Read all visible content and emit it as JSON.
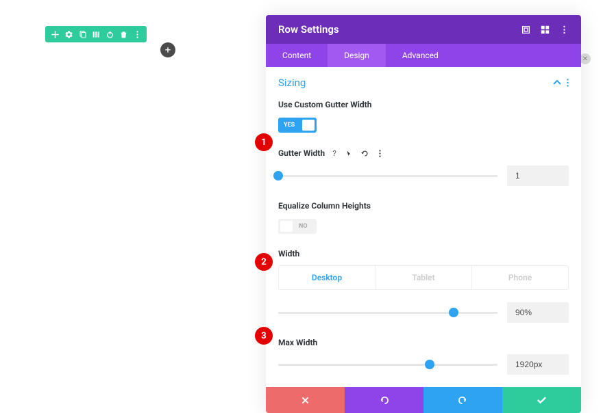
{
  "toolbar": {
    "icons": [
      "move",
      "gear",
      "copy",
      "columns",
      "power",
      "trash",
      "more"
    ]
  },
  "modal": {
    "title": "Row Settings",
    "header_icons": [
      "expand",
      "grid",
      "more"
    ],
    "tabs": {
      "content": "Content",
      "design": "Design",
      "advanced": "Advanced"
    },
    "active_tab": "design"
  },
  "section": {
    "title": "Sizing"
  },
  "fields": {
    "use_custom_gutter": {
      "label": "Use Custom Gutter Width",
      "toggle_text": "YES"
    },
    "gutter_width": {
      "label": "Gutter Width",
      "value": "1",
      "thumb_pct": 0
    },
    "equalize": {
      "label": "Equalize Column Heights",
      "toggle_text": "NO"
    },
    "width": {
      "label": "Width",
      "value": "90%",
      "thumb_pct": 80,
      "responsive": {
        "desktop": "Desktop",
        "tablet": "Tablet",
        "phone": "Phone"
      }
    },
    "max_width": {
      "label": "Max Width",
      "value": "1920px",
      "thumb_pct": 69
    }
  },
  "annotations": {
    "a1": "1",
    "a2": "2",
    "a3": "3"
  }
}
